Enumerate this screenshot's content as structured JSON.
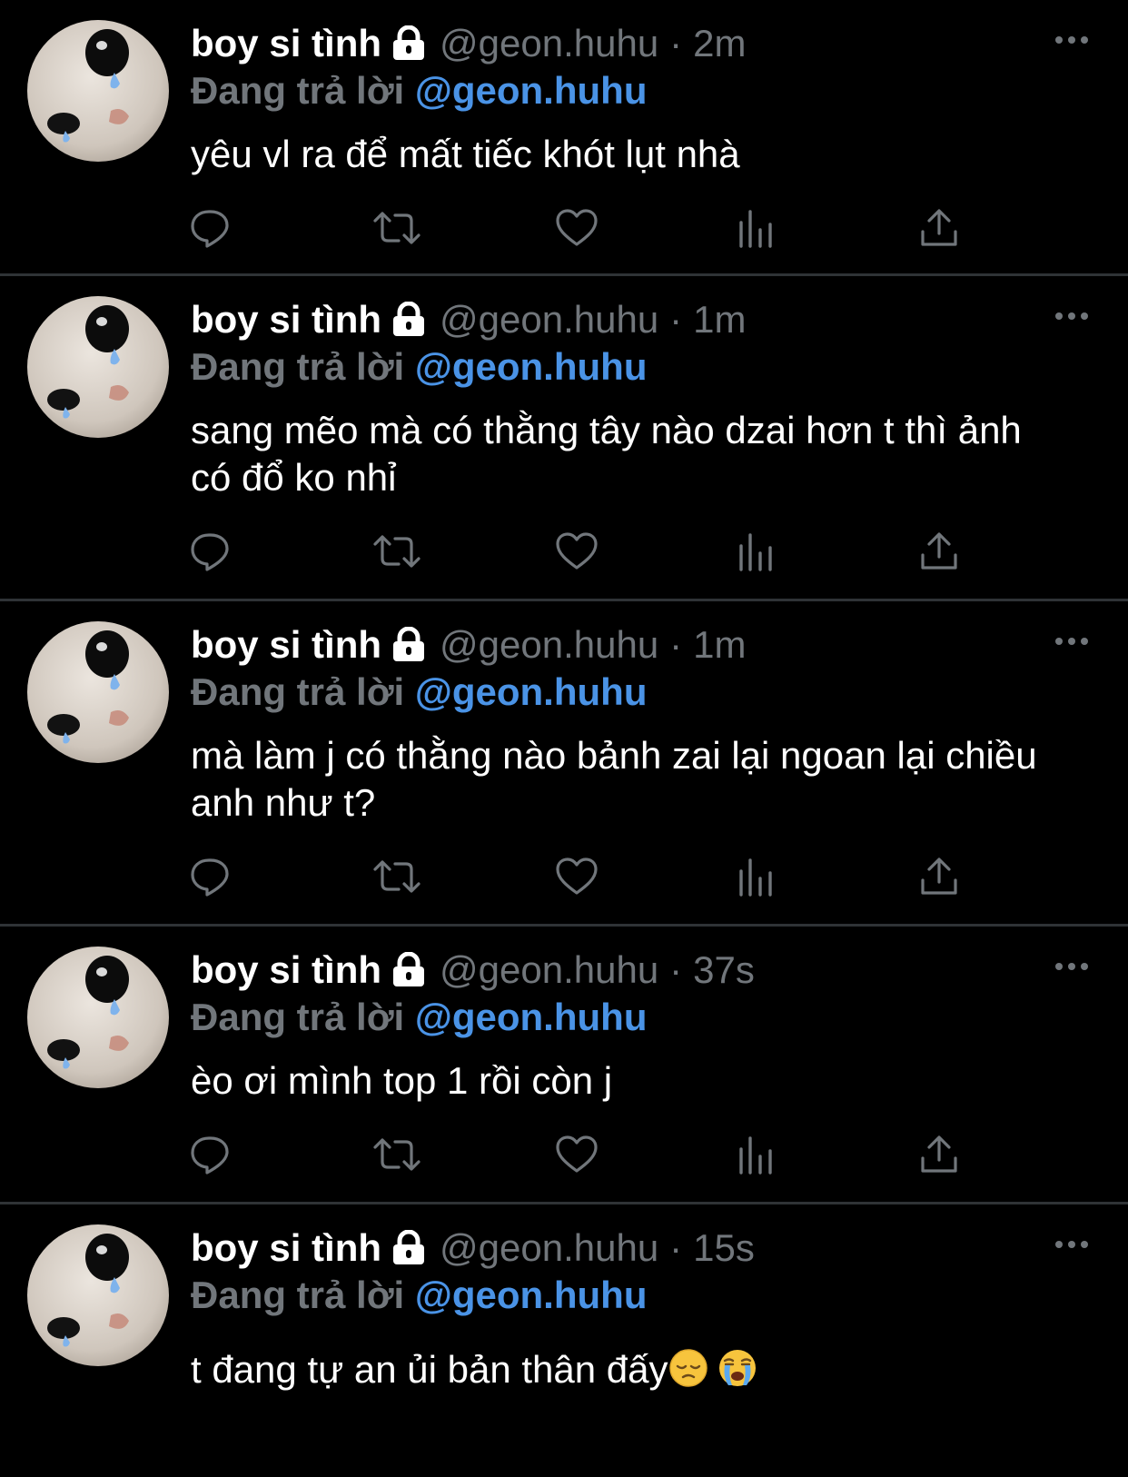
{
  "colors": {
    "background": "#000000",
    "text": "#ffffff",
    "secondary": "#71767b",
    "mention": "#4a93e6",
    "divider": "#2f3336"
  },
  "icons": {
    "lock": "lock-icon",
    "more": "more-icon",
    "reply": "reply-icon",
    "retweet": "retweet-icon",
    "like": "heart-icon",
    "views": "analytics-icon",
    "share": "share-icon"
  },
  "tweets": [
    {
      "name": "boy si tình",
      "handle": "@geon.huhu",
      "dot": "·",
      "time": "2m",
      "reply_prefix": "Đang trả lời",
      "reply_to": "@geon.huhu",
      "text": "yêu vl ra để mất tiếc khót lụt nhà"
    },
    {
      "name": "boy si tình",
      "handle": "@geon.huhu",
      "dot": "·",
      "time": "1m",
      "reply_prefix": "Đang trả lời",
      "reply_to": "@geon.huhu",
      "text": "sang mẽo mà có thằng tây nào dzai hơn t thì ảnh có đổ ko nhỉ"
    },
    {
      "name": "boy si tình",
      "handle": "@geon.huhu",
      "dot": "·",
      "time": "1m",
      "reply_prefix": "Đang trả lời",
      "reply_to": "@geon.huhu",
      "text": "mà làm j có thằng nào bảnh zai lại ngoan lại chiều anh như t?"
    },
    {
      "name": "boy si tình",
      "handle": "@geon.huhu",
      "dot": "·",
      "time": "37s",
      "reply_prefix": "Đang trả lời",
      "reply_to": "@geon.huhu",
      "text": "èo ơi mình top 1 rồi còn j"
    },
    {
      "name": "boy si tình",
      "handle": "@geon.huhu",
      "dot": "·",
      "time": "15s",
      "reply_prefix": "Đang trả lời",
      "reply_to": "@geon.huhu",
      "text": "t đang tự an ủi bản thân đấy",
      "emojis": [
        "pensive-face",
        "crying-face"
      ]
    }
  ]
}
